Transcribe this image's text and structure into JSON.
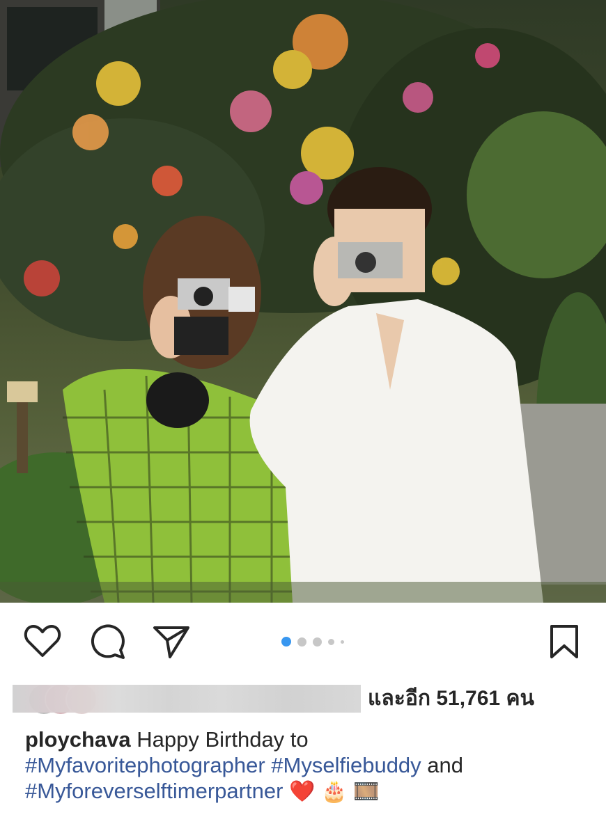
{
  "post": {
    "photo": {
      "description_icon": "photo-image",
      "colors": {
        "sky": "#2f3a26",
        "foliage": "#2d3b22",
        "shirt_green": "#8fc03a",
        "shirt_white": "#f4f3ef"
      }
    },
    "actions": {
      "like_icon": "heart-icon",
      "comment_icon": "comment-icon",
      "share_icon": "send-icon",
      "save_icon": "bookmark-icon"
    },
    "carousel": {
      "total": 5,
      "active": 1,
      "active_color": "#3897f0"
    },
    "likes": {
      "text": "และอีก 51,761 คน"
    },
    "caption": {
      "username": "ploychava",
      "text": " Happy Birthday to ",
      "hashtag1": "#Myfavoritephotographer",
      "hashtag2": "#Myselfiebuddy",
      "and": " and ",
      "hashtag3": "#Myforeverselftimerpartner",
      "emoji1": "❤️",
      "emoji2": "🎂",
      "emoji3": "🎞️"
    }
  }
}
